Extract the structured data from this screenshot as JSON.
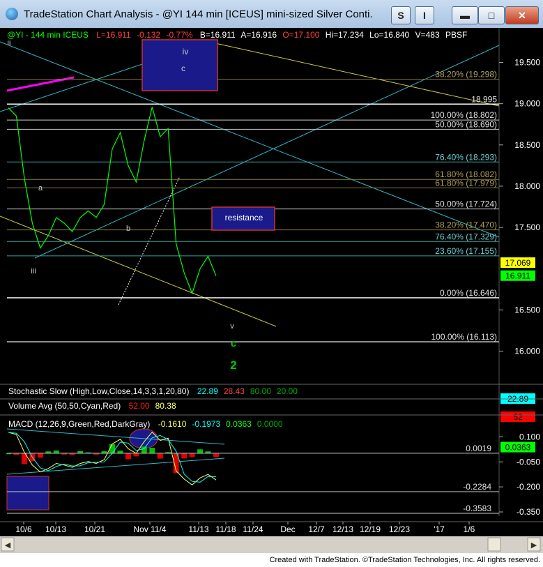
{
  "window": {
    "title": "TradeStation Chart Analysis - @YI 144 min [ICEUS] mini-sized Silver Conti...",
    "btn_s": "S",
    "btn_i": "I"
  },
  "header": {
    "symbol": "@YI - 144 min  ICEUS",
    "last": "L=16.911",
    "change": "-0.132",
    "pct": "-0.77%",
    "bid": "B=16.911",
    "ask": "A=16.916",
    "open": "O=17.100",
    "high": "Hi=17.234",
    "low": "Lo=16.840",
    "vol": "V=483",
    "extra": "PBSF"
  },
  "price_panel": {
    "ylim": [
      15.75,
      19.75
    ],
    "ticks": [
      {
        "v": 19.5,
        "label": "19.500"
      },
      {
        "v": 19.0,
        "label": "19.000"
      },
      {
        "v": 18.5,
        "label": "18.500"
      },
      {
        "v": 18.0,
        "label": "18.000"
      },
      {
        "v": 17.5,
        "label": "17.500"
      },
      {
        "v": 16.5,
        "label": "16.500"
      },
      {
        "v": 16.0,
        "label": "16.000"
      }
    ],
    "last_boxes": [
      {
        "v": 17.069,
        "label": "17.069",
        "bg": "#ffff00",
        "fg": "#000000"
      },
      {
        "v": 16.911,
        "label": "16.911",
        "bg": "#00ff00",
        "fg": "#000000"
      }
    ],
    "fib_levels": [
      {
        "v": 19.298,
        "label": "38.20% (19.298)",
        "color": "#8a7a3a"
      },
      {
        "v": 18.995,
        "label": "18.995",
        "color": "#ffffff"
      },
      {
        "v": 18.802,
        "label": "100.00% (18.802)",
        "color": "#cccccc"
      },
      {
        "v": 18.69,
        "label": "50.00% (18.690)",
        "color": "#cccccc"
      },
      {
        "v": 18.293,
        "label": "76.40% (18.293)",
        "color": "#3aa0a0"
      },
      {
        "v": 18.082,
        "label": "61.80% (18.082)",
        "color": "#8a7a3a"
      },
      {
        "v": 17.979,
        "label": "61.80% (17.979)",
        "color": "#8a7a3a"
      },
      {
        "v": 17.724,
        "label": "50.00% (17.724)",
        "color": "#cccccc"
      },
      {
        "v": 17.47,
        "label": "38.20% (17.470)",
        "color": "#8a7a3a"
      },
      {
        "v": 17.329,
        "label": "76.40% (17.329)",
        "color": "#3aa0a0"
      },
      {
        "v": 17.155,
        "label": "23.60% (17.155)",
        "color": "#3aa0a0"
      },
      {
        "v": 16.646,
        "label": "0.00% (16.646)",
        "color": "#ffffff"
      },
      {
        "v": 16.113,
        "label": "100.00% (16.113)",
        "color": "#cccccc"
      }
    ],
    "wave_labels": [
      {
        "text": "ii",
        "color": "#cccccc"
      },
      {
        "text": "a",
        "color": "#cccccc"
      },
      {
        "text": "iii",
        "color": "#cccccc"
      },
      {
        "text": "b",
        "color": "#cccccc"
      },
      {
        "text": "iv",
        "color": "#cccccc"
      },
      {
        "text": "c",
        "color": "#cccccc"
      },
      {
        "text": "v",
        "color": "#cccccc"
      },
      {
        "text": "c",
        "color": "#00cc00"
      },
      {
        "text": "2",
        "color": "#00cc00"
      }
    ],
    "resistance_label": "resistance"
  },
  "stochastic": {
    "label": "Stochastic Slow (High,Low,Close,14,3,3,1,20,80)",
    "values": [
      {
        "text": "22.89",
        "color": "#00ffff"
      },
      {
        "text": "28.43",
        "color": "#ff4040"
      },
      {
        "text": "80.00",
        "color": "#00b000"
      },
      {
        "text": "20.00",
        "color": "#00b000"
      }
    ],
    "axis_box": {
      "label": "22.89",
      "bg": "#00ffff"
    }
  },
  "volume": {
    "label": "Volume Avg (50,50,Cyan,Red)",
    "values": [
      {
        "text": "52.00",
        "color": "#ff2020"
      },
      {
        "text": "80.38",
        "color": "#ffff60"
      }
    ],
    "axis_box": {
      "label": "52",
      "bg": "#ff0000"
    }
  },
  "macd": {
    "label": "MACD (12,26,9,Green,Red,DarkGray)",
    "values": [
      {
        "text": "-0.1610",
        "color": "#ffff60"
      },
      {
        "text": "-0.1973",
        "color": "#00ffff"
      },
      {
        "text": "0.0363",
        "color": "#00ff00"
      },
      {
        "text": "0.0000",
        "color": "#00b000"
      }
    ],
    "ylim": [
      -0.4,
      0.16
    ],
    "ticks": [
      {
        "v": 0.1,
        "label": "0.100"
      },
      {
        "v": -0.05,
        "label": "-0.050"
      },
      {
        "v": -0.2,
        "label": "-0.200"
      },
      {
        "v": -0.35,
        "label": "-0.350"
      }
    ],
    "levels": [
      {
        "v": 0.0019,
        "label": "0.0019"
      },
      {
        "v": -0.2284,
        "label": "-0.2284"
      },
      {
        "v": -0.3583,
        "label": "-0.3583"
      }
    ],
    "axis_box": {
      "label": "0.0363",
      "bg": "#00ff00"
    }
  },
  "x_axis": {
    "labels": [
      "10/6",
      "10/13",
      "10/21",
      "Nov 11/4",
      "11/13",
      "11/18",
      "11/24",
      "Dec",
      "12/7",
      "12/13",
      "12/19",
      "12/23",
      "'17",
      "1/6"
    ]
  },
  "chart_data": {
    "type": "line",
    "title": "@YI - 144 min  ICEUS",
    "xlabel": "",
    "ylabel": "",
    "ylim": [
      15.75,
      19.75
    ],
    "x": [
      "10/6",
      "10/13",
      "10/21",
      "11/4",
      "11/13"
    ],
    "series": [
      {
        "name": "@YI",
        "values": [
          18.95,
          18.85,
          18.1,
          17.55,
          17.25,
          17.4,
          17.62,
          17.55,
          17.45,
          17.62,
          17.7,
          17.62,
          17.78,
          18.45,
          18.65,
          18.25,
          18.05,
          18.55,
          18.96,
          18.6,
          18.7,
          17.3,
          16.95,
          16.7,
          17.0,
          17.15,
          16.911
        ]
      }
    ]
  },
  "footer": "Created with TradeStation. ©TradeStation Technologies, Inc. All rights reserved."
}
